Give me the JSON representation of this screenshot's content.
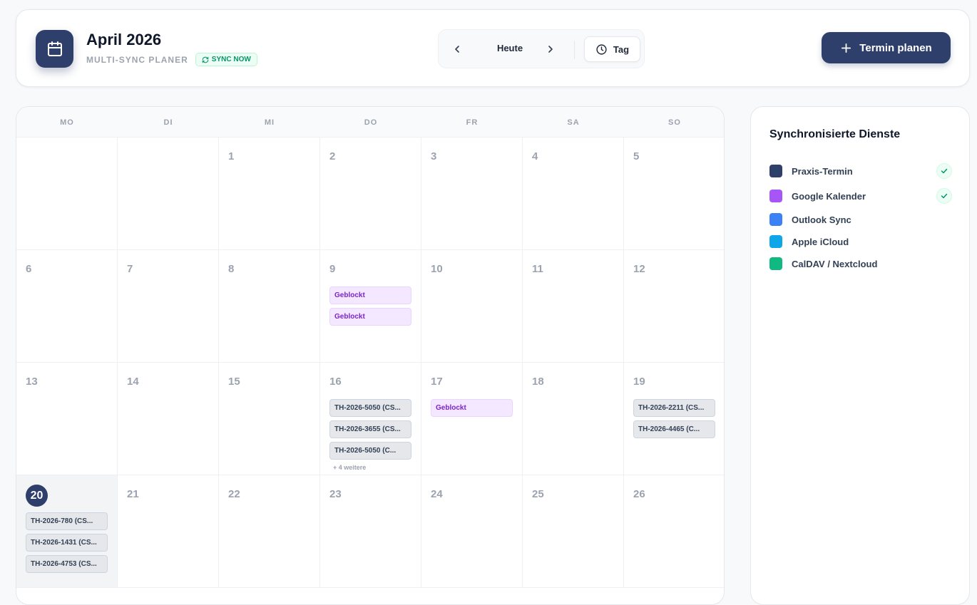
{
  "header": {
    "title": "April 2026",
    "subtitle": "MULTI-SYNC PLANER",
    "sync_badge": "SYNC NOW",
    "today_label": "Heute",
    "view_label": "Tag",
    "add_button_label": "Termin planen"
  },
  "calendar": {
    "weekdays": [
      "MO",
      "DI",
      "MI",
      "DO",
      "FR",
      "SA",
      "SO"
    ],
    "weeks": [
      [
        {
          "day": "",
          "events": []
        },
        {
          "day": "",
          "events": []
        },
        {
          "day": "1",
          "events": []
        },
        {
          "day": "2",
          "events": []
        },
        {
          "day": "3",
          "events": []
        },
        {
          "day": "4",
          "events": []
        },
        {
          "day": "5",
          "events": []
        }
      ],
      [
        {
          "day": "6",
          "events": []
        },
        {
          "day": "7",
          "events": []
        },
        {
          "day": "8",
          "events": []
        },
        {
          "day": "9",
          "events": [
            {
              "label": "Geblockt",
              "type": "blocked"
            },
            {
              "label": "Geblockt",
              "type": "blocked"
            }
          ]
        },
        {
          "day": "10",
          "events": []
        },
        {
          "day": "11",
          "events": []
        },
        {
          "day": "12",
          "events": []
        }
      ],
      [
        {
          "day": "13",
          "events": []
        },
        {
          "day": "14",
          "events": []
        },
        {
          "day": "15",
          "events": []
        },
        {
          "day": "16",
          "events": [
            {
              "label": "TH-2026-5050 (CS...",
              "type": "booking"
            },
            {
              "label": "TH-2026-3655 (CS...",
              "type": "booking"
            },
            {
              "label": "TH-2026-5050 (C...",
              "type": "booking"
            }
          ],
          "more": "+ 4 weitere"
        },
        {
          "day": "17",
          "events": [
            {
              "label": "Geblockt",
              "type": "blocked"
            }
          ]
        },
        {
          "day": "18",
          "events": []
        },
        {
          "day": "19",
          "events": [
            {
              "label": "TH-2026-2211 (CS...",
              "type": "booking"
            },
            {
              "label": "TH-2026-4465 (C...",
              "type": "booking"
            }
          ]
        }
      ],
      [
        {
          "day": "20",
          "today": true,
          "events": [
            {
              "label": "TH-2026-780 (CS...",
              "type": "booking"
            },
            {
              "label": "TH-2026-1431 (CS...",
              "type": "booking"
            },
            {
              "label": "TH-2026-4753 (CS...",
              "type": "booking"
            }
          ]
        },
        {
          "day": "21",
          "events": []
        },
        {
          "day": "22",
          "events": []
        },
        {
          "day": "23",
          "events": []
        },
        {
          "day": "24",
          "events": []
        },
        {
          "day": "25",
          "events": []
        },
        {
          "day": "26",
          "events": []
        }
      ]
    ]
  },
  "services": {
    "title": "Synchronisierte Dienste",
    "items": [
      {
        "name": "Praxis-Termin",
        "color": "#2f3f6b",
        "synced": true
      },
      {
        "name": "Google Kalender",
        "color": "#a855f7",
        "synced": true
      },
      {
        "name": "Outlook Sync",
        "color": "#3b82f6",
        "synced": false
      },
      {
        "name": "Apple iCloud",
        "color": "#0ea5e9",
        "synced": false
      },
      {
        "name": "CalDAV / Nextcloud",
        "color": "#10b981",
        "synced": false
      }
    ]
  },
  "colors": {
    "primary": "#2f3f6b",
    "blocked_text": "#7e22ce",
    "success": "#059669"
  }
}
